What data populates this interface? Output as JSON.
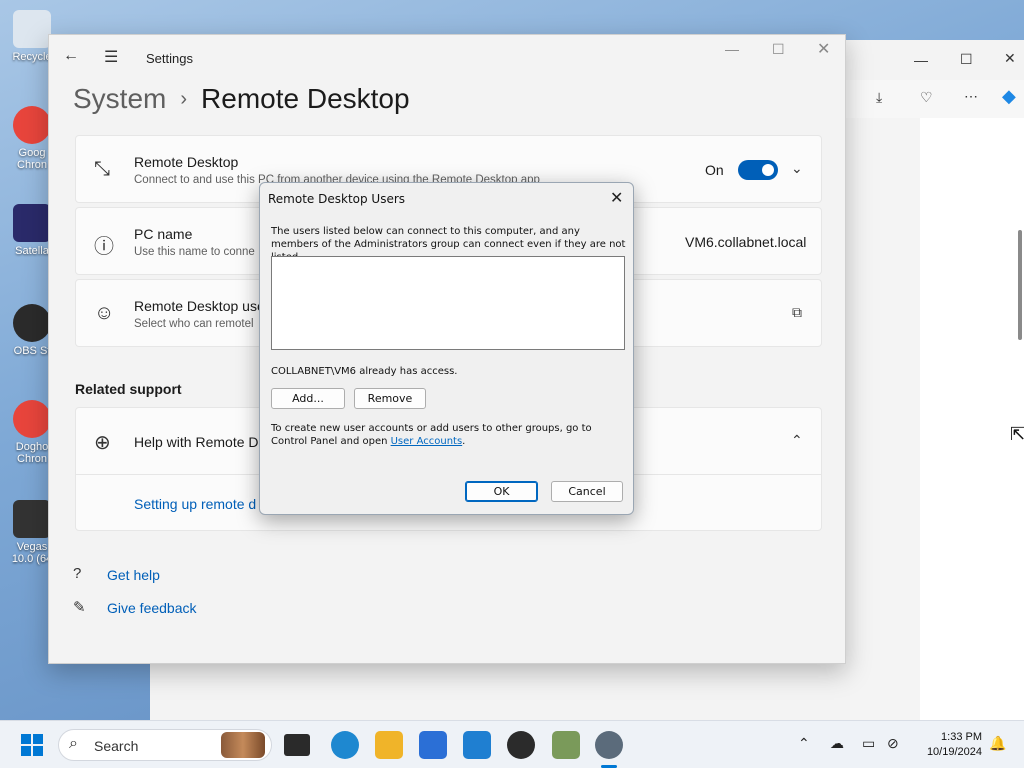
{
  "desktop": {
    "icons": [
      {
        "label": "Recycle",
        "color": "#dde6ef"
      },
      {
        "label": "Goog Chron",
        "color": "#e8453c"
      },
      {
        "label": "Satella",
        "color": "#2a2a6a"
      },
      {
        "label": "OBS St",
        "color": "#2b2b2b"
      },
      {
        "label": "Dogho Chron",
        "color": "#e8453c"
      },
      {
        "label": "Vegas 10.0 (64",
        "color": "#333333"
      }
    ]
  },
  "settings": {
    "app_title": "Settings",
    "breadcrumb_parent": "System",
    "breadcrumb_separator": "›",
    "page_title": "Remote Desktop",
    "cards": {
      "remote_desktop": {
        "title": "Remote Desktop",
        "desc": "Connect to and use this PC from another device using the Remote Desktop app",
        "toggle_label": "On"
      },
      "pc_name": {
        "title": "PC name",
        "desc": "Use this name to conne",
        "value": "VM6.collabnet.local"
      },
      "users": {
        "title": "Remote Desktop use",
        "desc": "Select who can remotel"
      }
    },
    "related_support": "Related support",
    "help": {
      "title": "Help with Remote De",
      "link": "Setting up remote d"
    },
    "footer": {
      "get_help": "Get help",
      "give_feedback": "Give feedback"
    }
  },
  "dialog": {
    "title": "Remote Desktop Users",
    "intro": "The users listed below can connect to this computer, and any members of the Administrators group can connect even if they are not listed.",
    "access_text": "COLLABNET\\VM6 already has access.",
    "add_button": "Add...",
    "remove_button": "Remove",
    "info_text": "To create new user accounts or add users to other groups, go to Control Panel and open ",
    "info_link": "User Accounts",
    "info_end": ".",
    "ok_button": "OK",
    "cancel_button": "Cancel"
  },
  "taskbar": {
    "search_placeholder": "Search",
    "time": "1:33 PM",
    "date": "10/19/2024"
  },
  "colors": {
    "accent": "#005fb8",
    "start": "#0078d4"
  }
}
